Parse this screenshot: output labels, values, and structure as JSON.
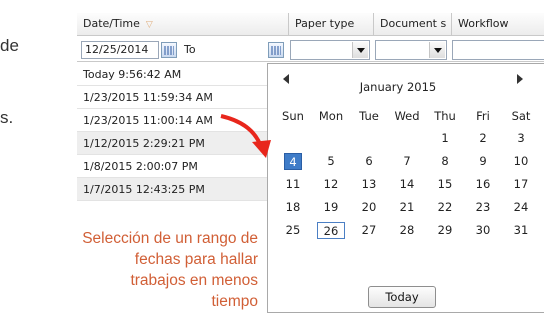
{
  "background": {
    "text_de": "de",
    "text_s": "s."
  },
  "caption": {
    "lines": [
      "Selección de un rango de",
      "fechas para hallar",
      "trabajos en menos",
      "tiempo"
    ]
  },
  "grid": {
    "headers": {
      "date_time": "Date/Time",
      "paper_type": "Paper type",
      "document": "Document s",
      "workflow": "Workflow"
    },
    "filter": {
      "date_from": "12/25/2014",
      "to_label": "To"
    },
    "rows": [
      "Today 9:56:42 AM",
      "1/23/2015 11:59:34 AM",
      "1/23/2015 11:00:14 AM",
      "1/12/2015 2:29:21 PM",
      "1/8/2015 2:00:07 PM",
      "1/7/2015 12:43:25 PM"
    ]
  },
  "calendar": {
    "title": "January 2015",
    "weekdays": [
      "Sun",
      "Mon",
      "Tue",
      "Wed",
      "Thu",
      "Fri",
      "Sat"
    ],
    "weeks": [
      [
        "",
        "",
        "",
        "",
        "1",
        "2",
        "3"
      ],
      [
        "4",
        "5",
        "6",
        "7",
        "8",
        "9",
        "10"
      ],
      [
        "11",
        "12",
        "13",
        "14",
        "15",
        "16",
        "17"
      ],
      [
        "18",
        "19",
        "20",
        "21",
        "22",
        "23",
        "24"
      ],
      [
        "25",
        "26",
        "27",
        "28",
        "29",
        "30",
        "31"
      ]
    ],
    "selected_day": "4",
    "today_day": "26",
    "today_button": "Today"
  },
  "colors": {
    "accent": "#d15f36",
    "arrow": "#e8261c",
    "selection": "#3f7cc8"
  },
  "icons": [
    "filter-icon",
    "calendar-icon",
    "dropdown-arrow-icon",
    "prev-month-icon",
    "next-month-icon",
    "pointer-arrow-icon"
  ]
}
